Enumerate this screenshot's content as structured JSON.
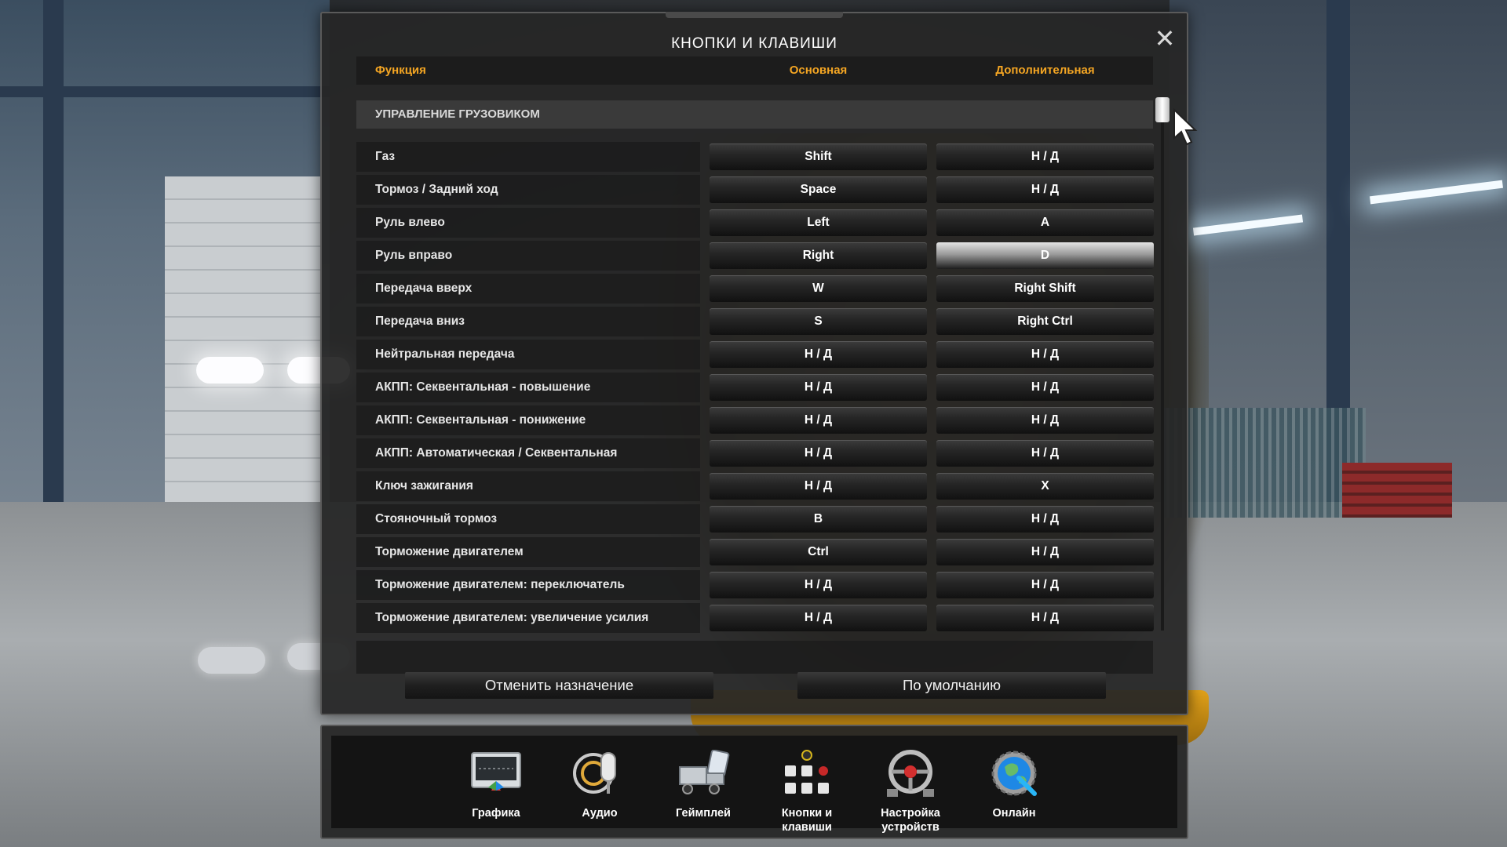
{
  "dialog": {
    "title": "КНОПКИ И КЛАВИШИ",
    "close_icon": "close-icon"
  },
  "table": {
    "headers": {
      "function": "Функция",
      "primary": "Основная",
      "secondary": "Дополнительная"
    },
    "section_title": "УПРАВЛЕНИЕ ГРУЗОВИКОМ",
    "rows": [
      {
        "fn": "Газ",
        "primary": "Shift",
        "secondary": "Н / Д"
      },
      {
        "fn": "Тормоз / Задний ход",
        "primary": "Space",
        "secondary": "Н / Д"
      },
      {
        "fn": "Руль влево",
        "primary": "Left",
        "secondary": "A"
      },
      {
        "fn": "Руль вправо",
        "primary": "Right",
        "secondary": "D"
      },
      {
        "fn": "Передача вверх",
        "primary": "W",
        "secondary": "Right Shift"
      },
      {
        "fn": "Передача вниз",
        "primary": "S",
        "secondary": "Right Ctrl"
      },
      {
        "fn": "Нейтральная передача",
        "primary": "Н / Д",
        "secondary": "Н / Д"
      },
      {
        "fn": "АКПП: Секвентальная - повышение",
        "primary": "Н / Д",
        "secondary": "Н / Д"
      },
      {
        "fn": "АКПП: Секвентальная - понижение",
        "primary": "Н / Д",
        "secondary": "Н / Д"
      },
      {
        "fn": "АКПП: Автоматическая / Секвентальная",
        "primary": "Н / Д",
        "secondary": "Н / Д"
      },
      {
        "fn": "Ключ зажигания",
        "primary": "Н / Д",
        "secondary": "X"
      },
      {
        "fn": "Стояночный тормоз",
        "primary": "B",
        "secondary": "Н / Д"
      },
      {
        "fn": "Торможение двигателем",
        "primary": "Ctrl",
        "secondary": "Н / Д"
      },
      {
        "fn": "Торможение двигателем: переключатель",
        "primary": "Н / Д",
        "secondary": "Н / Д"
      },
      {
        "fn": "Торможение двигателем: увеличение усилия",
        "primary": "Н / Д",
        "secondary": "Н / Д"
      }
    ]
  },
  "actions": {
    "unbind_label": "Отменить назначение",
    "defaults_label": "По умолчанию"
  },
  "menu": {
    "items": [
      {
        "label": "Графика",
        "icon": "monitor-icon"
      },
      {
        "label": "Аудио",
        "icon": "microphone-icon"
      },
      {
        "label": "Геймплей",
        "icon": "truck-icon"
      },
      {
        "label": "Кнопки и клавиши",
        "icon": "keys-icon"
      },
      {
        "label": "Настройка устройств",
        "icon": "steering-wheel-icon"
      },
      {
        "label": "Онлайн",
        "icon": "globe-icon"
      }
    ]
  },
  "colors": {
    "accent": "#f5a623",
    "text": "#ffffff",
    "panel": "#262626"
  }
}
